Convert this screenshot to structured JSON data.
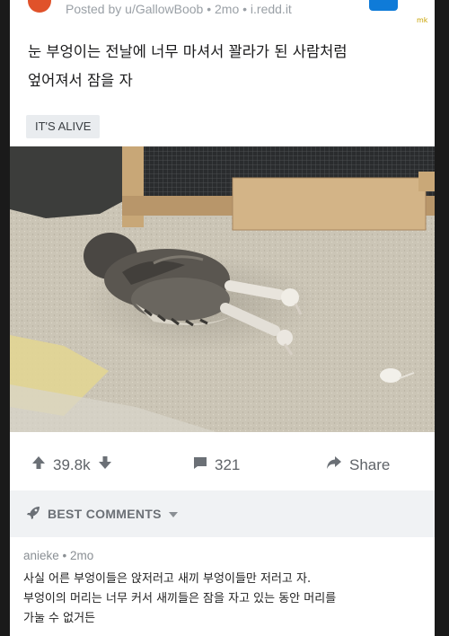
{
  "post": {
    "posted_by": "Posted by u/GallowBoob • 2mo • i.redd.it",
    "watermark": "mk",
    "title_line1": "눈 부엉이는 전날에 너무 마셔서 꽐라가 된 사람처럼",
    "title_line2": "엎어져서 잠을 자",
    "flair": "IT'S ALIVE",
    "image": "owlet-lying-face-down-on-sand"
  },
  "actions": {
    "upvotes": "39.8k",
    "comments": "321",
    "share_label": "Share",
    "icons": [
      "upvote-arrow-icon",
      "downvote-arrow-icon",
      "comment-icon",
      "share-arrow-icon"
    ]
  },
  "sort": {
    "label": "BEST COMMENTS",
    "icons": [
      "rocket-icon",
      "caret-down-icon"
    ]
  },
  "comment": {
    "meta": "anieke • 2mo",
    "line1": "사실 어른 부엉이들은 앉저러고 새끼 부엉이들만 저러고 자.",
    "line2": "부엉이의 머리는 너무 커서 새끼들은 잠을 자고 있는 동안 머리를",
    "line3": "가눌 수 없거든"
  },
  "colors": {
    "avatar": "#e0522a",
    "join_button": "#0f7bd8",
    "flair_bg": "#e9ecef",
    "sort_bar_bg": "#f0f2f4"
  }
}
